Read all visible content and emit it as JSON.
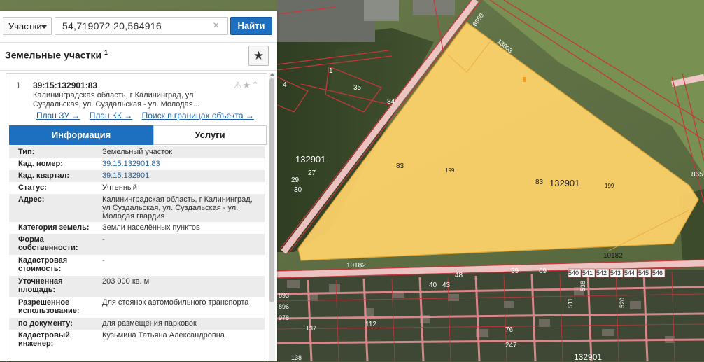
{
  "search": {
    "type_label": "Участки",
    "query": "54,719072 20,564916",
    "clear_glyph": "×",
    "button_label": "Найти"
  },
  "section": {
    "title": "Земельные участки",
    "count": "1",
    "fav_glyph": "★"
  },
  "result": {
    "index": "1.",
    "cad_number": "39:15:132901:83",
    "address": "Калининградская область, г Калининград, ул Суздальская, ул. Суздальская - ул. Молодая...",
    "icons": "⚠★⌃",
    "links": [
      "План ЗУ →",
      "План КК →",
      "Поиск в границах объекта →"
    ],
    "tabs": {
      "info": "Информация",
      "services": "Услуги"
    },
    "properties": [
      {
        "key": "Тип:",
        "value": "Земельный участок"
      },
      {
        "key": "Кад. номер:",
        "value": "39:15:132901:83"
      },
      {
        "key": "Кад. квартал:",
        "value": "39:15:132901"
      },
      {
        "key": "Статус:",
        "value": "Учтенный"
      },
      {
        "key": "Адрес:",
        "value": "Калининградская область, г Калининград, ул Суздальская, ул. Суздальская - ул. Молодая гвардия"
      },
      {
        "key": "Категория земель:",
        "value": "Земли населённых пунктов"
      },
      {
        "key": "Форма собственности:",
        "value": "-"
      },
      {
        "key": "Кадастровая стоимость:",
        "value": "-"
      },
      {
        "key": "Уточненная площадь:",
        "value": "203 000 кв. м"
      },
      {
        "key": "Разрешенное использование:",
        "value": "Для стоянок автомобильного транспорта"
      },
      {
        "key": "по документу:",
        "value": "для размещения парковок"
      },
      {
        "key": "Кадастровый инженер:",
        "value": "Кузьмина Татьяна Александровна"
      }
    ]
  },
  "map": {
    "parcel_color": "#ffd36a",
    "labels": {
      "quarter_main": "132901",
      "quarter_left": "132901",
      "quarter_bottom": "132901",
      "parcel_83a": "83",
      "parcel_83b": "83",
      "parcel_199a": "199",
      "parcel_199b": "199",
      "road_10182a": "10182",
      "road_10182b": "10182",
      "road_84": "84",
      "road_8650": "8650",
      "road_13003": "13003",
      "p1": "1",
      "p35": "35",
      "p4": "4",
      "p865": "865",
      "p48": "48",
      "p59": "59",
      "p69": "69",
      "p40": "40",
      "p43": "43",
      "p112": "112",
      "p247": "247",
      "p76": "76",
      "p29": "29",
      "p30": "30",
      "p27": "27",
      "p540": "540",
      "p541": "541",
      "p542": "542",
      "p543": "543",
      "p544": "544",
      "p545": "545",
      "p546": "546",
      "p511": "511",
      "p538": "538",
      "p520": "520",
      "p893": "893",
      "p896": "896",
      "p978": "978",
      "p137": "137",
      "p138": "138"
    }
  }
}
